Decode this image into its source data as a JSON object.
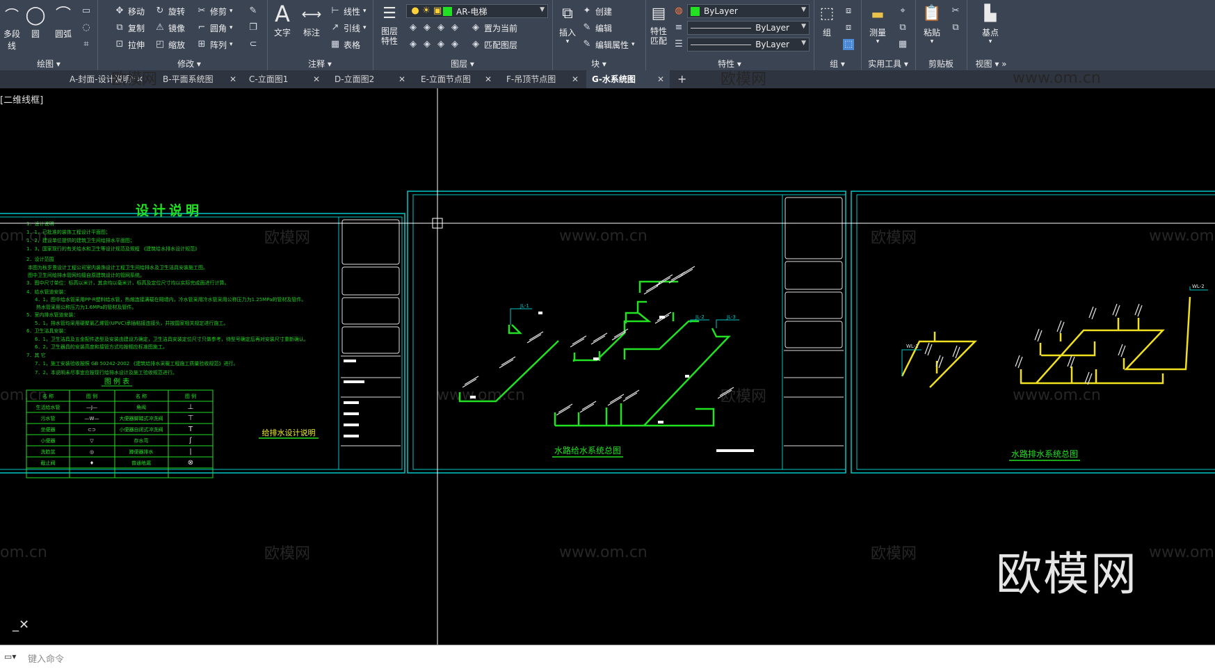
{
  "ribbon": {
    "draw_panel": {
      "title": "绘图",
      "polyline": "多段线",
      "circle": "圆",
      "arc": "圆弧"
    },
    "modify_panel": {
      "title": "修改",
      "move": "移动",
      "rotate": "旋转",
      "trim": "修剪",
      "copy": "复制",
      "mirror": "镜像",
      "fillet": "圆角",
      "stretch": "拉伸",
      "scale": "缩放",
      "array": "阵列"
    },
    "annotation_panel": {
      "title": "注释",
      "text": "文字",
      "dimension": "标注",
      "linear": "线性",
      "leader": "引线",
      "table": "表格"
    },
    "layers_panel": {
      "title": "图层",
      "layer_properties": "图层\n特性",
      "current_layer": "AR-电梯",
      "set_current": "置为当前",
      "match_layer": "匹配图层"
    },
    "block_panel": {
      "title": "块",
      "insert": "插入",
      "create": "创建",
      "edit": "编辑",
      "edit_attributes": "编辑属性"
    },
    "properties_panel": {
      "title": "特性",
      "match_properties": "特性\n匹配",
      "color": "ByLayer",
      "linetype": "ByLayer",
      "lineweight": "ByLayer"
    },
    "group_panel": {
      "title": "组",
      "group": "组"
    },
    "utilities_panel": {
      "title": "实用工具",
      "measure": "测量"
    },
    "clipboard_panel": {
      "title": "剪贴板",
      "paste": "粘贴"
    },
    "view_panel": {
      "title": "视图",
      "base": "基点"
    }
  },
  "tabs": [
    {
      "label": "A-封面-设计说明*"
    },
    {
      "label": "B-平面系统图"
    },
    {
      "label": "C-立面图1"
    },
    {
      "label": "D-立面图2"
    },
    {
      "label": "E-立面节点图"
    },
    {
      "label": "F-吊顶节点图"
    },
    {
      "label": "G-水系统图"
    }
  ],
  "view_label": "二维线框",
  "watermark": {
    "brand": "欧模网",
    "url": "www.om.cn",
    "short": "om.cn"
  },
  "drawing": {
    "sheet1": {
      "title": "设计说明",
      "notes": [
        "1．设计说明",
        "1．1，已批准的装饰工程设计平面图；",
        "1．2，建设单位提供的建筑卫生间给排水平面图；",
        "1．3，国家现行的有关给水和卫生等设计规范及规程 《建筑给水排水设计规范》",
        "2．设计范围",
        "本图为秋岁恩设计工程公司室内装饰设计工程卫生间给排水及卫生洁具安装施工图。",
        "图中卫生间给排水管网均接自原建筑设计的管网系统。",
        "3．图中尺寸单位：标高以米计，其余均以毫米计，标高及定位尺寸均以实际完成面进行计算。",
        "4．给水管道安装：",
        "4．1，图中给水管采用PP-R塑料给水管，热熔连接满载在隔墙内，冷水管采用冷水管采用公称压力为1.25MPa的管材及管件。",
        "热水管采用公称压力为1.6MPa的管材及管件。",
        "5．室内排水管道安装：",
        "5．1，排水管均采用硬聚氯乙烯管(UPVC)承插粘接连接头，并按国家相关规定进行施工。",
        "6．卫生洁具安装：",
        "6．1，卫生洁具及五金配件选型及安装由建设方确定，卫生洁具安装定位尺寸只做参考，待型号确定后再对安装尺寸重新确认。",
        "6．2，卫生器具的安装高度和接管方式均按相应标准图施工。",
        "7．其 它",
        "7．1，施工安装验收按照 GB 50242-2002 《建筑给排水采暖工程施工质量验收规范》进行。",
        "7．2，本说明未尽事宜应按现行给排水设计及施工验收规范进行。"
      ],
      "legend_title": "图 例 表",
      "legend_headers": [
        "名 称",
        "图 例",
        "名 称",
        "图 例"
      ],
      "legend_rows": [
        [
          "生活给水管",
          "—J—",
          "角阀",
          "⊥"
        ],
        [
          "污水管",
          "—W—",
          "大便器脚踏式冲洗阀",
          "⊤"
        ],
        [
          "坐便器",
          "⊂⊃",
          "小便器自闭式冲洗阀",
          "T"
        ],
        [
          "小便器",
          "▽",
          "存水弯",
          "ʃ"
        ],
        [
          "洗脸盆",
          "◎",
          "蹲便器排水",
          "|"
        ],
        [
          "截止阀",
          "♦",
          "普通地漏",
          "⊗"
        ]
      ],
      "caption": "给排水设计说明"
    },
    "sheet2": {
      "caption": "水路给水系统总图",
      "labels": [
        "JL-1",
        "JL-2",
        "JL-3"
      ]
    },
    "sheet3": {
      "caption": "水路排水系统总图",
      "labels": [
        "WL-1",
        "WL-2"
      ]
    }
  },
  "command_line": {
    "placeholder": "键入命令"
  },
  "colors": {
    "ribbon": "#3b4453",
    "frame": "#00c8c8",
    "supply": "#22e022",
    "drain": "#f0e020",
    "text_yellow": "#f0f020"
  }
}
